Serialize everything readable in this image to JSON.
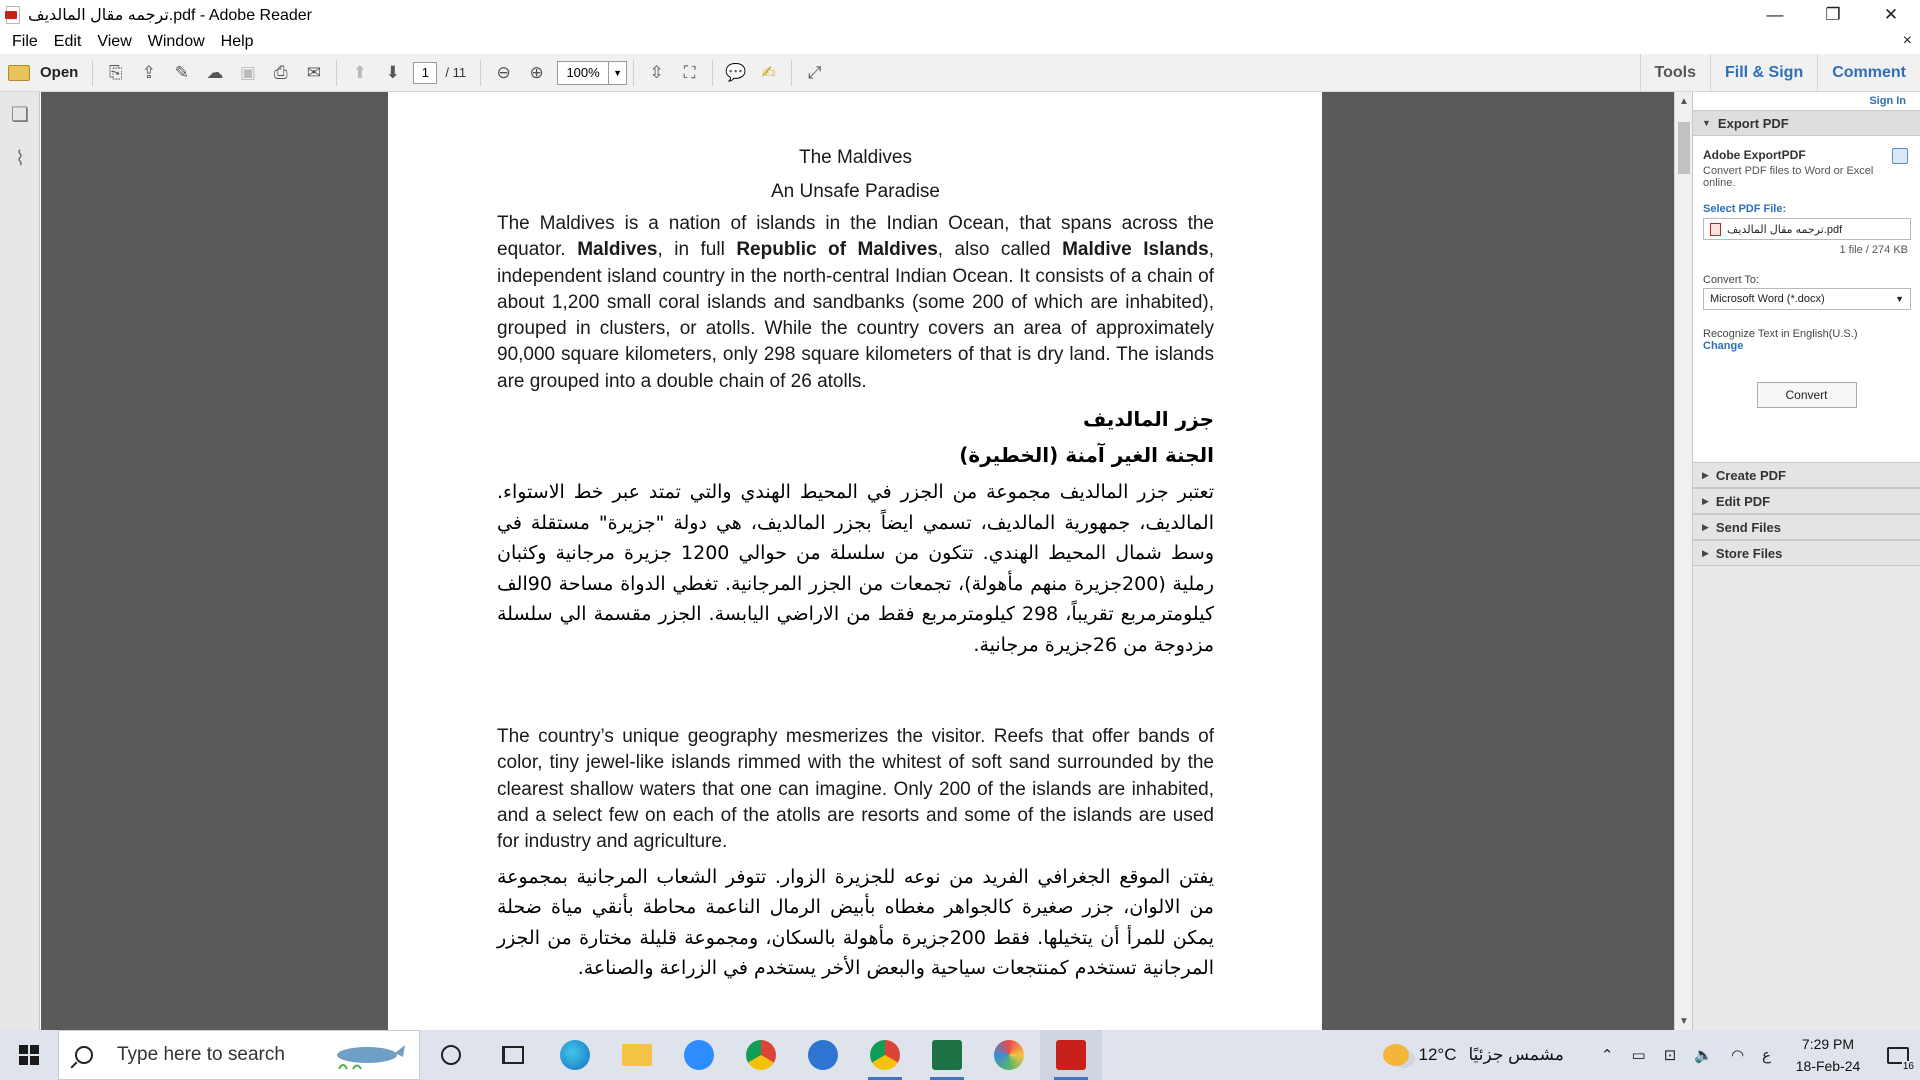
{
  "window": {
    "title": "ترجمه مقال المالديف.pdf - Adobe Reader",
    "minimize": "—",
    "restore": "❐",
    "close": "✕"
  },
  "menu": {
    "items": [
      "File",
      "Edit",
      "View",
      "Window",
      "Help"
    ],
    "close_doc": "×"
  },
  "toolbar": {
    "open_label": "Open",
    "page_current": "1",
    "page_total": "/ 11",
    "zoom": "100%",
    "tools_label": "Tools",
    "fill_sign_label": "Fill & Sign",
    "comment_label": "Comment"
  },
  "document": {
    "title": "The Maldives",
    "subtitle": "An Unsafe Paradise",
    "p1": {
      "t1": "The Maldives is a nation of islands in the Indian Ocean, that spans across the equator. ",
      "b1": "Maldives",
      "t2": ", in full ",
      "b2": "Republic of Maldives",
      "t3": ", also called ",
      "b3": "Maldive Islands",
      "t4": ", independent island country in the north-central Indian Ocean. It consists of a chain of about 1,200 small coral islands and sandbanks (some 200 of which are inhabited), grouped in clusters, or atolls. While the country covers an area of approximately 90,000 square kilometers, only 298 square kilometers of that is dry land. The islands are grouped into a double chain of 26 atolls."
    },
    "ar_title": "جزر المالديف",
    "ar_subtitle": "الجنة الغير آمنة (الخطيرة)",
    "ar_p1": "تعتبر جزر المالديف مجموعة من الجزر في المحيط الهندي والتي تمتد عبر خط الاستواء. المالديف، جمهورية المالديف، تسمي ايضاً بجزر المالديف، هي دولة \"جزيرة\" مستقلة في وسط شمال المحيط الهندي. تتكون من سلسلة من حوالي 1200 جزيرة مرجانية وكثبان رملية (200جزيرة منهم مأهولة)، تجمعات من الجزر المرجانية. تغطي الدواة مساحة 90الف كيلومترمربع تقريباً، 298 كيلومترمربع فقط من الاراضي اليابسة. الجزر مقسمة الي سلسلة مزدوجة من 26جزيرة مرجانية.",
    "p2": "The country’s unique geography mesmerizes the visitor. Reefs that offer bands of color, tiny jewel-like islands rimmed with the whitest of soft sand surrounded by the clearest shallow waters that one can imagine. Only 200 of the islands are inhabited, and a select few on each of the atolls are resorts and some of the islands are used for industry and agriculture.",
    "ar_p2": "يفتن الموقع الجغرافي الفريد من نوعه للجزيرة الزوار. تتوفر الشعاب المرجانية بمجموعة من الالوان، جزر صغيرة كالجواهر مغطاه بأبيض الرمال الناعمة محاطة بأنقي مياة ضحلة يمكن للمرأ أن يتخيلها. فقط 200جزيرة مأهولة بالسكان، ومجموعة قليلة مختارة من الجزر المرجانية تستخدم كمنتجعات سياحية والبعض الأخر يستخدم في الزراعة والصناعة."
  },
  "right_pane": {
    "sign_in": "Sign In",
    "export_header": "Export PDF",
    "export_title": "Adobe ExportPDF",
    "export_desc": "Convert PDF files to Word or Excel online.",
    "select_label": "Select PDF File:",
    "file_name": "ترجمه مقال المالديف.pdf",
    "file_size": "1 file / 274 KB",
    "convert_to_label": "Convert To:",
    "convert_to_value": "Microsoft Word (*.docx)",
    "recognize_text": "Recognize Text in English(U.S.)",
    "change_link": "Change",
    "convert_button": "Convert",
    "sections": [
      "Create PDF",
      "Edit PDF",
      "Send Files",
      "Store Files"
    ]
  },
  "taskbar": {
    "search_placeholder": "Type here to search",
    "temperature": "12°C",
    "weather_text": "مشمس جزئيًا",
    "ime": "ع",
    "time": "7:29 PM",
    "date": "18-Feb-24",
    "notification_count": "16"
  },
  "colors": {
    "accent_blue": "#2e6fb5",
    "doc_background": "#5a5a5a",
    "adobe_red": "#c8201b"
  }
}
